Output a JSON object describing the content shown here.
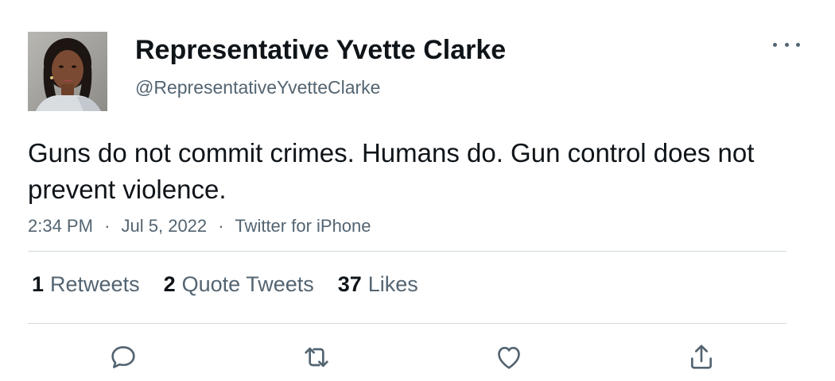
{
  "author": {
    "display_name": "Representative Yvette Clarke",
    "handle": "@RepresentativeYvetteClarke"
  },
  "tweet": {
    "text": "Guns do not commit crimes. Humans do. Gun control does not prevent violence.",
    "time": "2:34 PM",
    "date": "Jul 5, 2022",
    "source": "Twitter for iPhone",
    "separator": "·"
  },
  "stats": {
    "retweets_count": "1",
    "retweets_label": "Retweets",
    "quotes_count": "2",
    "quotes_label": "Quote Tweets",
    "likes_count": "37",
    "likes_label": "Likes"
  },
  "icons": {
    "more": "more-horizontal-icon",
    "reply": "reply-icon",
    "retweet": "retweet-icon",
    "like": "heart-icon",
    "share": "share-icon"
  },
  "colors": {
    "text_primary": "#0f1419",
    "text_secondary": "#536471",
    "divider": "#cfd9de"
  }
}
